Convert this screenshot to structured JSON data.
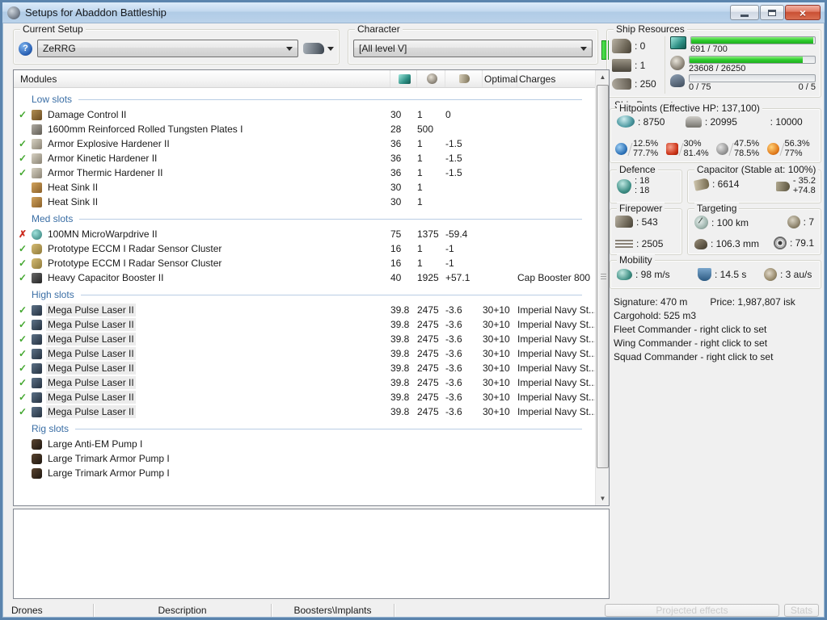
{
  "window": {
    "title": "Setups for Abaddon Battleship"
  },
  "toolbar": {
    "current_setup": {
      "label": "Current Setup",
      "help": "?",
      "value": "ZeRRG"
    },
    "character": {
      "label": "Character",
      "value": "[All level V]"
    }
  },
  "ship_resources": {
    "label": "Ship Resources",
    "turrets": ": 0",
    "launchers": ": 1",
    "calibration": ": 250",
    "cpu": {
      "text": "691 / 700",
      "pct": 98.7
    },
    "powergrid": {
      "text": "23608 / 26250",
      "pct": 90
    },
    "drones": {
      "text": "0 / 75",
      "bandwidth": "0 / 5",
      "pct": 0
    }
  },
  "ship_parameters": {
    "label": "Ship Parameters",
    "hitpoints": {
      "label": "Hitpoints (Effective HP: 137,100)",
      "shield": ": 8750",
      "armor": ": 20995",
      "structure": ": 10000",
      "resists": [
        {
          "name": "em",
          "top": "12.5%",
          "bottom": "77.7%"
        },
        {
          "name": "thermal",
          "top": "30%",
          "bottom": "81.4%"
        },
        {
          "name": "kinetic",
          "top": "47.5%",
          "bottom": "78.5%"
        },
        {
          "name": "explosive",
          "top": "56.3%",
          "bottom": "77%"
        }
      ]
    },
    "defence": {
      "label": "Defence",
      "value1": ": 18",
      "value2": ": 18"
    },
    "capacitor": {
      "label": "Capacitor (Stable at: 100%)",
      "amount": ": 6614",
      "peak_drain": "- 35.2",
      "recharge": "+74.8"
    },
    "firepower": {
      "label": "Firepower",
      "dps": ": 543",
      "volley": ": 2505"
    },
    "targeting": {
      "label": "Targeting",
      "range": ": 100 km",
      "max_targets": ": 7",
      "scan_resolution": ": 106.3 mm",
      "sensor_strength": ": 79.1"
    },
    "mobility": {
      "label": "Mobility",
      "speed": ": 98 m/s",
      "align_time": ": 14.5 s",
      "warp_speed": ": 3 au/s"
    },
    "info": {
      "signature": "Signature: 470 m",
      "price": "Price: 1,987,807 isk",
      "cargohold": "Cargohold: 525 m3",
      "fleet": "Fleet Commander - right click to set",
      "wing": "Wing Commander - right click to set",
      "squad": "Squad Commander - right click to set"
    }
  },
  "modules": {
    "header": {
      "title": "Modules",
      "optimal": "Optimal",
      "charges": "Charges"
    },
    "sections": [
      {
        "label": "Low slots",
        "rows": [
          {
            "status": "ok",
            "icon": "damage-control",
            "name": "Damage Control II",
            "cpu": "30",
            "pg": "1",
            "cap": "0",
            "optimal": "",
            "charges": ""
          },
          {
            "status": "none",
            "icon": "armor-plate",
            "name": "1600mm Reinforced Rolled Tungsten Plates I",
            "cpu": "28",
            "pg": "500",
            "cap": "",
            "optimal": "",
            "charges": ""
          },
          {
            "status": "ok",
            "icon": "armor-hardener",
            "name": "Armor Explosive Hardener II",
            "cpu": "36",
            "pg": "1",
            "cap": "-1.5",
            "optimal": "",
            "charges": ""
          },
          {
            "status": "ok",
            "icon": "armor-hardener",
            "name": "Armor Kinetic Hardener II",
            "cpu": "36",
            "pg": "1",
            "cap": "-1.5",
            "optimal": "",
            "charges": ""
          },
          {
            "status": "ok",
            "icon": "armor-hardener",
            "name": "Armor Thermic Hardener II",
            "cpu": "36",
            "pg": "1",
            "cap": "-1.5",
            "optimal": "",
            "charges": ""
          },
          {
            "status": "none",
            "icon": "heat-sink",
            "name": "Heat Sink II",
            "cpu": "30",
            "pg": "1",
            "cap": "",
            "optimal": "",
            "charges": ""
          },
          {
            "status": "none",
            "icon": "heat-sink",
            "name": "Heat Sink II",
            "cpu": "30",
            "pg": "1",
            "cap": "",
            "optimal": "",
            "charges": ""
          }
        ]
      },
      {
        "label": "Med slots",
        "rows": [
          {
            "status": "error",
            "icon": "microwarpdrive",
            "name": "100MN MicroWarpdrive II",
            "cpu": "75",
            "pg": "1375",
            "cap": "-59.4",
            "optimal": "",
            "charges": ""
          },
          {
            "status": "ok",
            "icon": "eccm",
            "name": "Prototype ECCM I Radar Sensor Cluster",
            "cpu": "16",
            "pg": "1",
            "cap": "-1",
            "optimal": "",
            "charges": ""
          },
          {
            "status": "ok",
            "icon": "eccm",
            "name": "Prototype ECCM I Radar Sensor Cluster",
            "cpu": "16",
            "pg": "1",
            "cap": "-1",
            "optimal": "",
            "charges": ""
          },
          {
            "status": "ok",
            "icon": "cap-booster",
            "name": "Heavy Capacitor Booster II",
            "cpu": "40",
            "pg": "1925",
            "cap": "+57.1",
            "optimal": "",
            "charges": "Cap Booster 800"
          }
        ]
      },
      {
        "label": "High slots",
        "rows": [
          {
            "status": "ok",
            "icon": "laser",
            "name": "Mega Pulse Laser II",
            "cpu": "39.8",
            "pg": "2475",
            "cap": "-3.6",
            "optimal": "30+10",
            "charges": "Imperial Navy St...",
            "highlight": true
          },
          {
            "status": "ok",
            "icon": "laser",
            "name": "Mega Pulse Laser II",
            "cpu": "39.8",
            "pg": "2475",
            "cap": "-3.6",
            "optimal": "30+10",
            "charges": "Imperial Navy St...",
            "highlight": true
          },
          {
            "status": "ok",
            "icon": "laser",
            "name": "Mega Pulse Laser II",
            "cpu": "39.8",
            "pg": "2475",
            "cap": "-3.6",
            "optimal": "30+10",
            "charges": "Imperial Navy St...",
            "highlight": true
          },
          {
            "status": "ok",
            "icon": "laser",
            "name": "Mega Pulse Laser II",
            "cpu": "39.8",
            "pg": "2475",
            "cap": "-3.6",
            "optimal": "30+10",
            "charges": "Imperial Navy St...",
            "highlight": true
          },
          {
            "status": "ok",
            "icon": "laser",
            "name": "Mega Pulse Laser II",
            "cpu": "39.8",
            "pg": "2475",
            "cap": "-3.6",
            "optimal": "30+10",
            "charges": "Imperial Navy St...",
            "highlight": true
          },
          {
            "status": "ok",
            "icon": "laser",
            "name": "Mega Pulse Laser II",
            "cpu": "39.8",
            "pg": "2475",
            "cap": "-3.6",
            "optimal": "30+10",
            "charges": "Imperial Navy St...",
            "highlight": true
          },
          {
            "status": "ok",
            "icon": "laser",
            "name": "Mega Pulse Laser II",
            "cpu": "39.8",
            "pg": "2475",
            "cap": "-3.6",
            "optimal": "30+10",
            "charges": "Imperial Navy St...",
            "highlight": true
          },
          {
            "status": "ok",
            "icon": "laser",
            "name": "Mega Pulse Laser II",
            "cpu": "39.8",
            "pg": "2475",
            "cap": "-3.6",
            "optimal": "30+10",
            "charges": "Imperial Navy St...",
            "highlight": true
          }
        ]
      },
      {
        "label": "Rig slots",
        "rows": [
          {
            "status": "none",
            "icon": "rig",
            "name": "Large Anti-EM Pump I",
            "cpu": "",
            "pg": "",
            "cap": "",
            "optimal": "",
            "charges": ""
          },
          {
            "status": "none",
            "icon": "rig",
            "name": "Large Trimark Armor Pump I",
            "cpu": "",
            "pg": "",
            "cap": "",
            "optimal": "",
            "charges": ""
          },
          {
            "status": "none",
            "icon": "rig",
            "name": "Large Trimark Armor Pump I",
            "cpu": "",
            "pg": "",
            "cap": "",
            "optimal": "",
            "charges": ""
          }
        ]
      }
    ]
  },
  "bottom_bar": {
    "drones": "Drones",
    "description": "Description",
    "boosters": "Boosters\\Implants",
    "projected_effects": "Projected effects",
    "stats": "Stats"
  }
}
